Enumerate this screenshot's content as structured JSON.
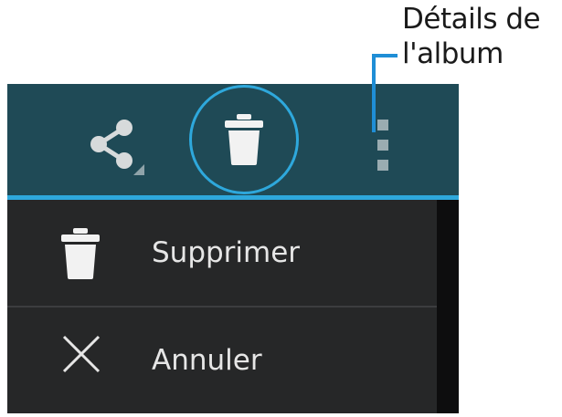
{
  "callout": {
    "line1": "Détails de",
    "line2": "l'album"
  },
  "action_bar": {
    "icons": [
      "share-icon",
      "trash-icon",
      "overflow-menu-icon"
    ],
    "background": "#1f4a56",
    "accent": "#2ea8dc",
    "highlighted": "trash-icon"
  },
  "menu": {
    "items": [
      {
        "icon": "trash-icon",
        "label": "Supprimer"
      },
      {
        "icon": "close-icon",
        "label": "Annuler"
      }
    ],
    "background": "#262728"
  }
}
